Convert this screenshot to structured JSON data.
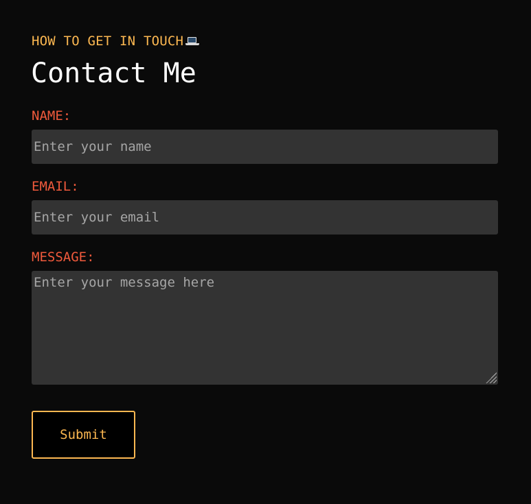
{
  "header": {
    "eyebrow": "HOW TO GET IN TOUCH",
    "eyebrow_icon": "laptop-icon",
    "title": "Contact Me"
  },
  "form": {
    "name": {
      "label": "NAME:",
      "placeholder": "Enter your name",
      "value": ""
    },
    "email": {
      "label": "EMAIL:",
      "placeholder": "Enter your email",
      "value": ""
    },
    "message": {
      "label": "MESSAGE:",
      "placeholder": "Enter your message here",
      "value": ""
    },
    "submit_label": "Submit"
  },
  "colors": {
    "background": "#0a0a0a",
    "accent": "#fdb851",
    "label": "#f05a3c",
    "field_background": "#333333",
    "text": "#ffffff"
  }
}
